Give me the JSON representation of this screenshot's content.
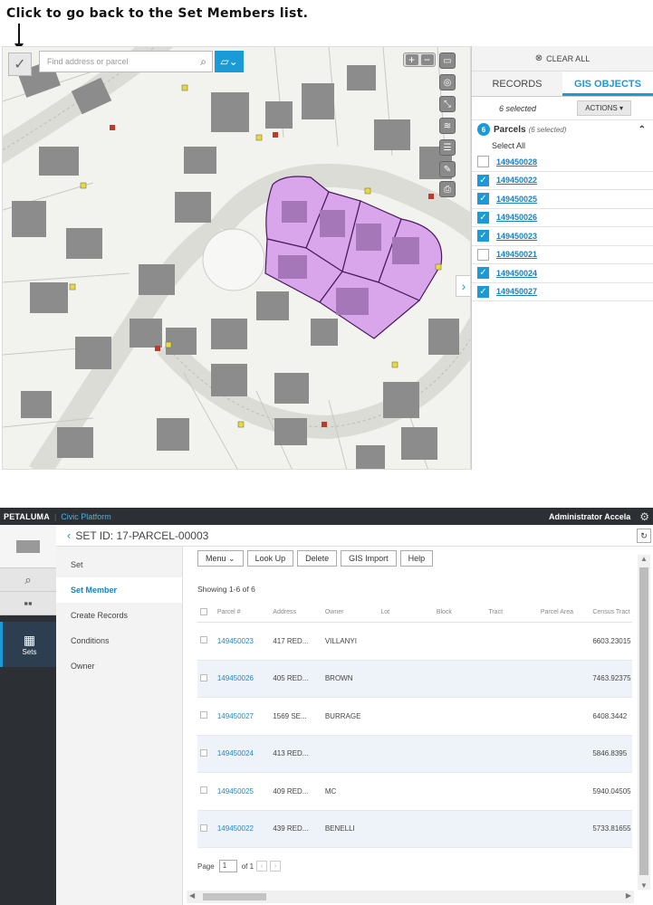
{
  "annotation": {
    "text": "Click to go back to the Set Members list."
  },
  "map": {
    "search_placeholder": "Find address or parcel",
    "back_glyph": "✓",
    "search_glyph": "⌕",
    "tool_glyph": "▱⌄",
    "zoom_in": "+",
    "zoom_out": "−",
    "expander_glyph": "›"
  },
  "gis_panel": {
    "clear_all": "CLEAR ALL",
    "tabs": [
      {
        "label": "RECORDS"
      },
      {
        "label": "GIS OBJECTS"
      }
    ],
    "selected_text": "6 selected",
    "actions_label": "ACTIONS ▾",
    "group": {
      "count": "6",
      "label": "Parcels",
      "sub": "(6 selected)"
    },
    "select_all": "Select All",
    "parcels": [
      {
        "id": "149450028",
        "checked": false
      },
      {
        "id": "149450022",
        "checked": true
      },
      {
        "id": "149450025",
        "checked": true
      },
      {
        "id": "149450026",
        "checked": true
      },
      {
        "id": "149450023",
        "checked": true
      },
      {
        "id": "149450021",
        "checked": false
      },
      {
        "id": "149450024",
        "checked": true
      },
      {
        "id": "149450027",
        "checked": true
      }
    ]
  },
  "app": {
    "brand": "PETALUMA",
    "platform": "Civic Platform",
    "user": "Administrator Accela",
    "set_id": "SET ID: 17-PARCEL-00003",
    "nav": {
      "sets_label": "Sets"
    },
    "side_menu": [
      "Set",
      "Set Member",
      "Create Records",
      "Conditions",
      "Owner"
    ],
    "toolbar": [
      "Menu ⌄",
      "Look Up",
      "Delete",
      "GIS Import",
      "Help"
    ],
    "showing": "Showing 1-6 of 6",
    "columns": [
      "Parcel #",
      "Address",
      "Owner",
      "Lot",
      "Block",
      "Tract",
      "Parcel Area",
      "Census Tract"
    ],
    "rows": [
      {
        "parcel": "149450023",
        "address": "417 RED...",
        "owner": "VILLANYI",
        "census": "6603.23015"
      },
      {
        "parcel": "149450026",
        "address": "405 RED...",
        "owner": "BROWN",
        "census": "7463.92375"
      },
      {
        "parcel": "149450027",
        "address": "1569 SE...",
        "owner": "BURRAGE",
        "census": "6408.3442"
      },
      {
        "parcel": "149450024",
        "address": "413 RED...",
        "owner": "",
        "census": "5846.8395"
      },
      {
        "parcel": "149450025",
        "address": "409 RED...",
        "owner": "MC",
        "census": "5940.04505"
      },
      {
        "parcel": "149450022",
        "address": "439 RED...",
        "owner": "BENELLI",
        "census": "5733.81655"
      }
    ],
    "pager": {
      "page_label": "Page",
      "page_value": "1",
      "of_label": "of 1"
    }
  }
}
